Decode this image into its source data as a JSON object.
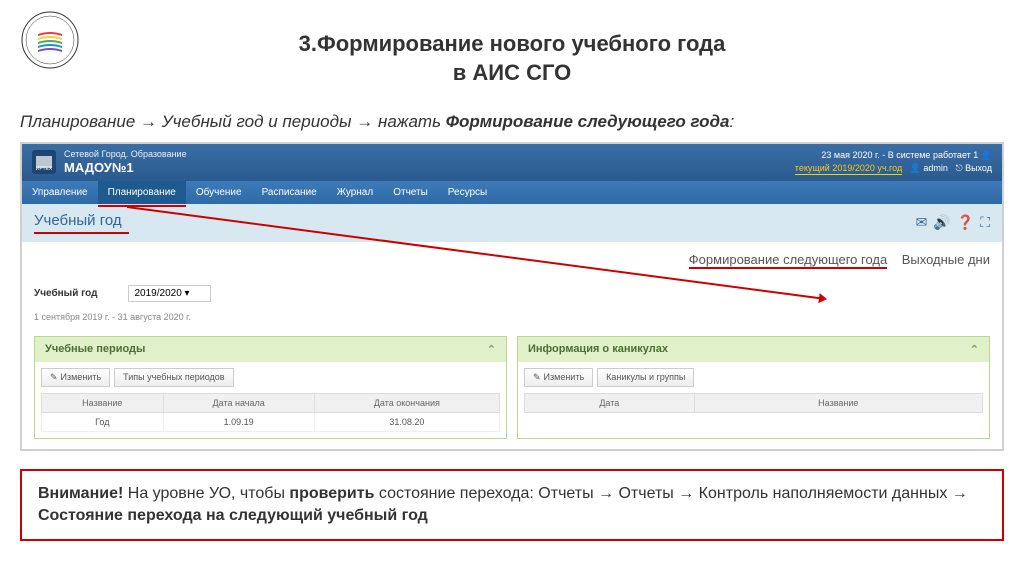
{
  "slide": {
    "title_line1": "3.Формирование нового учебного года",
    "title_line2": "в АИС СГО",
    "instruction_parts": [
      "Планирование",
      "Учебный год и периоды",
      "нажать",
      "Формирование следующего года",
      ":"
    ]
  },
  "app": {
    "subtitle": "Сетевой Город. Образование",
    "title": "МАДОУ№1",
    "date_info": "23 мая 2020 г. - В системе работает 1",
    "current_year_label": "текущий 2019/2020 уч.год",
    "user": "admin",
    "logout": "Выход"
  },
  "nav": {
    "items": [
      "Управление",
      "Планирование",
      "Обучение",
      "Расписание",
      "Журнал",
      "Отчеты",
      "Ресурсы"
    ]
  },
  "page": {
    "title": "Учебный год",
    "action_link1": "Формирование следующего года",
    "action_link2": "Выходные дни"
  },
  "year": {
    "label": "Учебный год",
    "value": "2019/2020",
    "dates": "1 сентября 2019 г. - 31 августа 2020 г."
  },
  "panel1": {
    "title": "Учебные периоды",
    "btn1": "Изменить",
    "btn2": "Типы учебных периодов",
    "cols": [
      "Название",
      "Дата начала",
      "Дата окончания"
    ],
    "row": [
      "Год",
      "1.09.19",
      "31.08.20"
    ]
  },
  "panel2": {
    "title": "Информация о каникулах",
    "btn1": "Изменить",
    "btn2": "Каникулы и группы",
    "cols": [
      "Дата",
      "Название"
    ]
  },
  "warning": {
    "prefix": "Внимание!",
    "text1": " На уровне УО, чтобы ",
    "bold1": "проверить",
    "text2": " состояние перехода: Отчеты → Отчеты → Контроль наполняемости данных → ",
    "bold2": "Состояние перехода на следующий учебный год"
  }
}
